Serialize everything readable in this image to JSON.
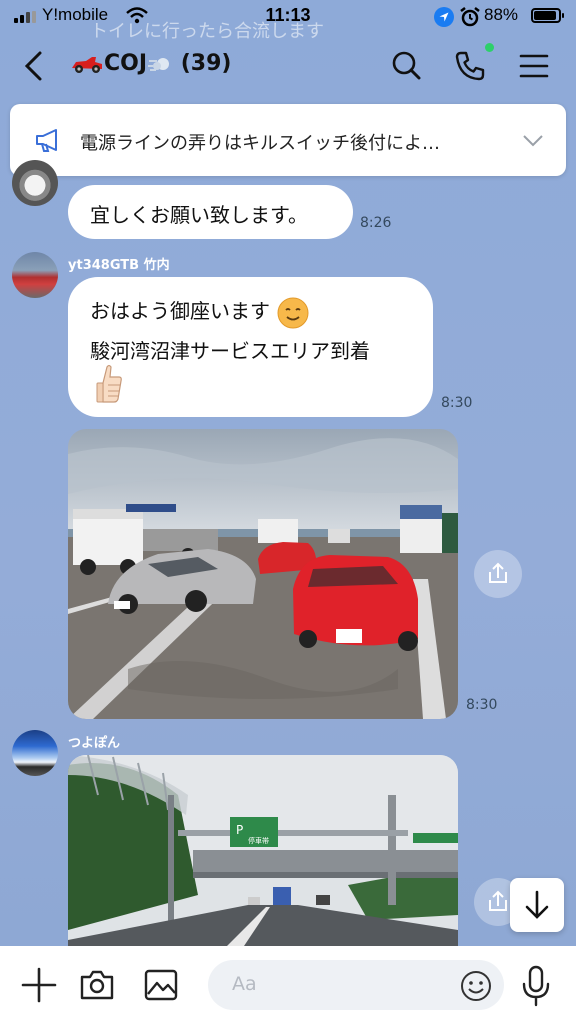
{
  "status_bar": {
    "carrier": "Y!mobile",
    "time": "11:13",
    "battery": "88%"
  },
  "ghost_text": "トイレに行ったら合流します",
  "header": {
    "title": "COJ",
    "member_count": "(39)"
  },
  "announcement": {
    "text": "電源ラインの弄りはキルスイッチ後付によ…"
  },
  "messages": [
    {
      "type": "text",
      "lines": [
        "宜しくお願い致します。"
      ],
      "time": "8:26"
    },
    {
      "type": "text",
      "sender": "yt348GTB 竹内",
      "lines": [
        "おはよう御座います",
        "駿河湾沼津サービスエリア到着"
      ],
      "time": "8:30"
    },
    {
      "type": "photo",
      "time": "8:30"
    },
    {
      "type": "photo",
      "sender": "つよぽん"
    }
  ],
  "sign_text": {
    "p": "P",
    "stop": "停車帯"
  },
  "composer": {
    "placeholder": "Aa"
  },
  "colors": {
    "chat_bg": "#8fa9d6",
    "accent_blue": "#1a7cf2",
    "online": "#2dd06a"
  }
}
